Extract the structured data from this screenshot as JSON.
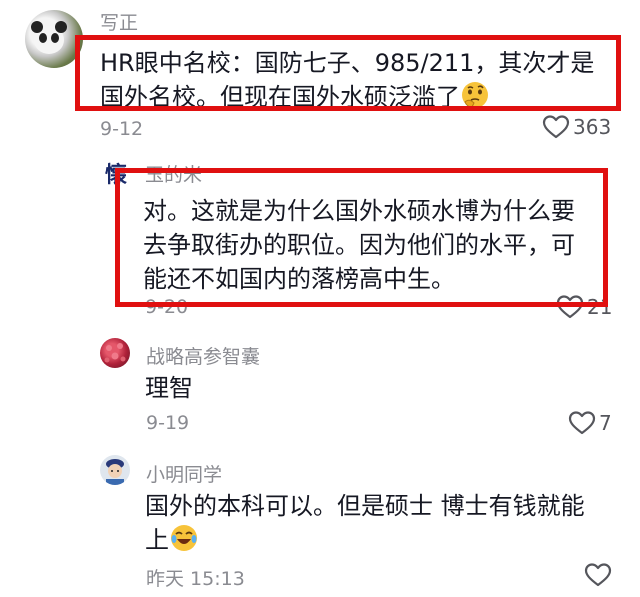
{
  "comments": [
    {
      "username": "写正",
      "text_line1": "HR眼中名校：国防七子、985/211，其次才是",
      "text_line2": "国外名校。但现在国外水硕泛滥了",
      "emoji": "thinking-face-emoji",
      "date": "9-12",
      "likes": "363",
      "highlighted": true
    },
    {
      "username": "玉的米",
      "text_line1": "对。这就是为什么国外水硕水博为什么要",
      "text_line2": "去争取街办的职位。因为他们的水平，可",
      "text_line3": "能还不如国内的落榜高中生。",
      "date": "9-20",
      "likes": "21",
      "highlighted": true
    },
    {
      "username": "战略高参智囊",
      "text_line1": "理智",
      "date": "9-19",
      "likes": "7"
    },
    {
      "username": "小明同学",
      "text_line1": "国外的本科可以。但是硕士 博士有钱就能",
      "text_line2": "上",
      "emoji": "laughing-face-emoji",
      "date": "昨天 15:13",
      "likes": ""
    }
  ],
  "colors": {
    "highlight_border": "#e01010",
    "text": "#161823",
    "meta": "#8a8b91"
  },
  "icons": [
    "heart-outline-icon"
  ]
}
